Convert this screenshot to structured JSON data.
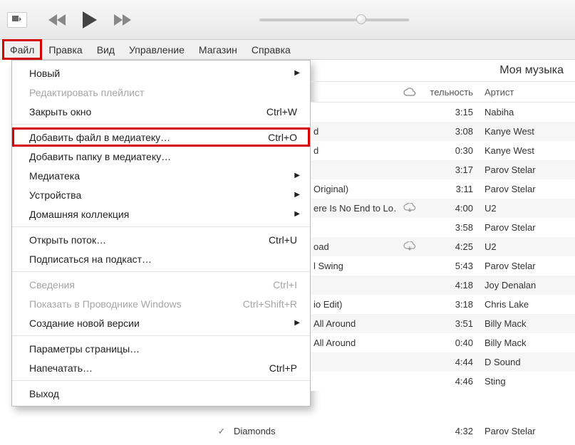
{
  "menubar": [
    "Файл",
    "Правка",
    "Вид",
    "Управление",
    "Магазин",
    "Справка"
  ],
  "dropdown": [
    {
      "type": "item",
      "label": "Новый",
      "submenu": true
    },
    {
      "type": "item",
      "label": "Редактировать плейлист",
      "disabled": true
    },
    {
      "type": "item",
      "label": "Закрыть окно",
      "shortcut": "Ctrl+W"
    },
    {
      "type": "sep"
    },
    {
      "type": "item",
      "label": "Добавить файл в медиатеку…",
      "shortcut": "Ctrl+O",
      "highlighted": true
    },
    {
      "type": "item",
      "label": "Добавить папку в медиатеку…"
    },
    {
      "type": "item",
      "label": "Медиатека",
      "submenu": true
    },
    {
      "type": "item",
      "label": "Устройства",
      "submenu": true
    },
    {
      "type": "item",
      "label": "Домашняя коллекция",
      "submenu": true
    },
    {
      "type": "sep"
    },
    {
      "type": "item",
      "label": "Открыть поток…",
      "shortcut": "Ctrl+U"
    },
    {
      "type": "item",
      "label": "Подписаться на подкаст…"
    },
    {
      "type": "sep"
    },
    {
      "type": "item",
      "label": "Сведения",
      "shortcut": "Ctrl+I",
      "disabled": true
    },
    {
      "type": "item",
      "label": "Показать в Проводнике Windows",
      "shortcut": "Ctrl+Shift+R",
      "disabled": true
    },
    {
      "type": "item",
      "label": "Создание новой версии",
      "submenu": true
    },
    {
      "type": "sep"
    },
    {
      "type": "item",
      "label": "Параметры страницы…"
    },
    {
      "type": "item",
      "label": "Напечатать…",
      "shortcut": "Ctrl+P"
    },
    {
      "type": "sep"
    },
    {
      "type": "item",
      "label": "Выход"
    }
  ],
  "content_title": "Моя музыка",
  "columns": {
    "duration": "тельность",
    "artist": "Артист"
  },
  "tracks": [
    {
      "name": "",
      "cloud": false,
      "dur": "3:15",
      "artist": "Nabiha"
    },
    {
      "name": "d",
      "cloud": false,
      "dur": "3:08",
      "artist": "Kanye West"
    },
    {
      "name": "d",
      "cloud": false,
      "dur": "0:30",
      "artist": "Kanye West"
    },
    {
      "name": "",
      "cloud": false,
      "dur": "3:17",
      "artist": "Parov Stelar"
    },
    {
      "name": "Original)",
      "cloud": false,
      "dur": "3:11",
      "artist": "Parov Stelar"
    },
    {
      "name": "ere Is No End to Lo…",
      "cloud": true,
      "dur": "4:00",
      "artist": "U2"
    },
    {
      "name": "",
      "cloud": false,
      "dur": "3:58",
      "artist": "Parov Stelar"
    },
    {
      "name": "oad",
      "cloud": true,
      "dur": "4:25",
      "artist": "U2"
    },
    {
      "name": "l Swing",
      "cloud": false,
      "dur": "5:43",
      "artist": "Parov Stelar"
    },
    {
      "name": "",
      "cloud": false,
      "dur": "4:18",
      "artist": "Joy Denalan"
    },
    {
      "name": "io Edit)",
      "cloud": false,
      "dur": "3:18",
      "artist": "Chris Lake"
    },
    {
      "name": "All Around",
      "cloud": false,
      "dur": "3:51",
      "artist": "Billy Mack"
    },
    {
      "name": "All Around",
      "cloud": false,
      "dur": "0:40",
      "artist": "Billy Mack"
    },
    {
      "name": "",
      "cloud": false,
      "dur": "4:44",
      "artist": "D Sound"
    },
    {
      "name": "",
      "cloud": false,
      "dur": "4:46",
      "artist": "Sting"
    }
  ],
  "bottom_track": {
    "name": "Diamonds",
    "dur": "4:32",
    "artist": "Parov Stelar"
  }
}
